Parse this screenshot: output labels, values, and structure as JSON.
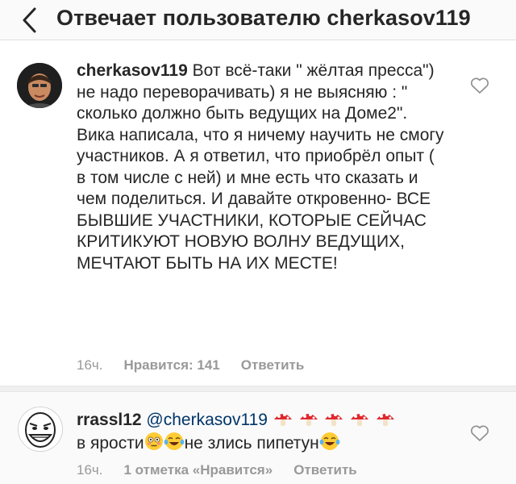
{
  "header": {
    "title": "Отвечает пользователю cherkasov119"
  },
  "comments": [
    {
      "username": "cherkasov119",
      "text": "Вот всё-таки \" жёлтая пресса\") не надо переворачивать) я не выясняю : \" сколько должно быть ведущих на Доме2\". Вика написала, что я ничему научить не смогу участников. А я ответил, что приобрёл опыт ( в том числе с ней) и мне есть что сказать и чем поделиться. И давайте откровенно- ВСЕ БЫВШИЕ УЧАСТНИКИ, КОТОРЫЕ СЕЙЧАС КРИТИКУЮТ НОВУЮ ВОЛНУ ВЕДУЩИХ, МЕЧТАЮТ БЫТЬ НА ИХ МЕСТЕ!",
      "time": "16ч.",
      "likes": "Нравится: 141",
      "reply": "Ответить"
    },
    {
      "username": "rrassl12",
      "mention": "@cherkasov119",
      "text_part1": "в ярости",
      "text_part2": "не злись пипетун",
      "time": "16ч.",
      "likes": "1 отметка «Нравится»",
      "reply": "Ответить"
    }
  ],
  "icons": {
    "back": "chevron-left-icon",
    "like": "heart-outline-icon",
    "mushroom": "mushroom-emoji",
    "flushed": "flushed-face-emoji",
    "joy": "tears-of-joy-emoji"
  },
  "colors": {
    "text": "#262626",
    "muted": "#999999",
    "mention": "#003569",
    "mushroom_cap": "#e0282e"
  }
}
